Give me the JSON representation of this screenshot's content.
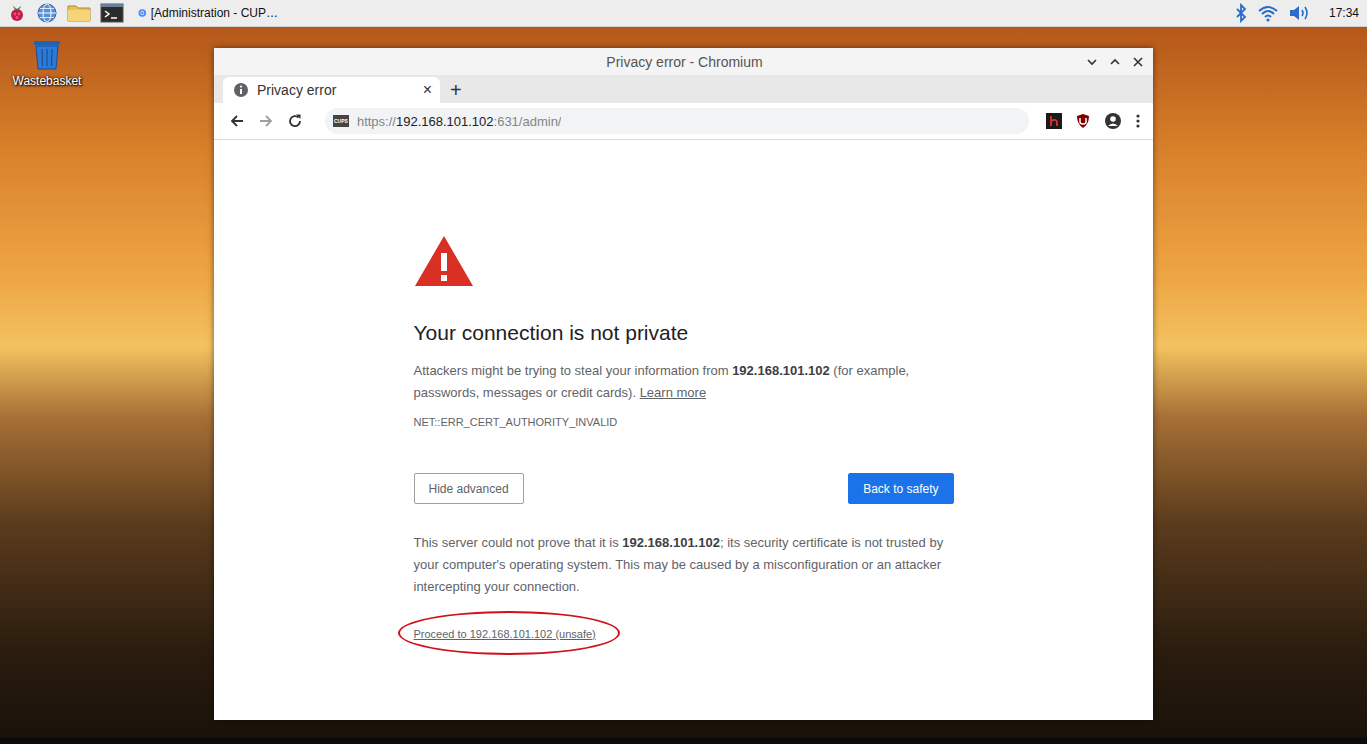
{
  "taskbar": {
    "task": {
      "label": "[Administration - CUP…",
      "active": false
    },
    "clock": "17:34"
  },
  "desktop": {
    "icons": [
      {
        "label": "Wastebasket"
      }
    ]
  },
  "window": {
    "title": "Privacy error - Chromium"
  },
  "tabs": [
    {
      "label": "Privacy error",
      "selected": true,
      "close": "×"
    }
  ],
  "new_tab": "+",
  "address_bar": {
    "favicon": "CUPS",
    "scheme": "https://",
    "host": "192.168.101.102",
    "path": ":631/admin/"
  },
  "page": {
    "heading": "Your connection is not private",
    "intro": {
      "before": "Attackers might be trying to steal your information from ",
      "host": "192.168.101.102",
      "after": " (for example, passwords, messages or credit cards). ",
      "link": "Learn more"
    },
    "error_code": "NET::ERR_CERT_AUTHORITY_INVALID",
    "buttons": [
      {
        "label": "Hide advanced",
        "primary": false
      },
      {
        "label": "Back to safety",
        "primary": true
      }
    ],
    "details": {
      "before": "This server could not prove that it is ",
      "host": "192.168.101.102",
      "after": "; its security certificate is not trusted by your computer's operating system. This may be caused by a misconfiguration or an attacker intercepting your connection."
    },
    "proceed_link": {
      "label": "Proceed to 192.168.101.102 (unsafe)",
      "highlighted": true
    }
  }
}
